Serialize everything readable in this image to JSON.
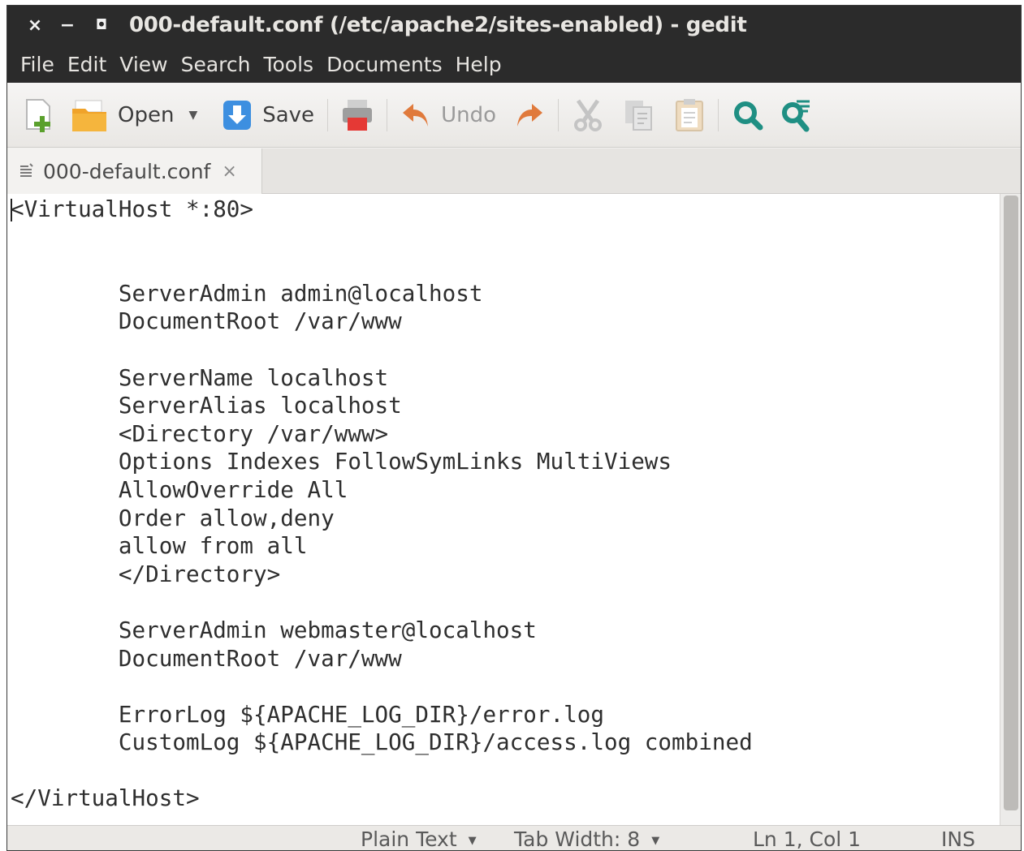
{
  "window": {
    "title": "000-default.conf (/etc/apache2/sites-enabled) - gedit",
    "controls": {
      "close": "×",
      "minimize": "−",
      "maximize": "◘"
    }
  },
  "menu": {
    "items": [
      "File",
      "Edit",
      "View",
      "Search",
      "Tools",
      "Documents",
      "Help"
    ]
  },
  "toolbar": {
    "open_label": "Open",
    "save_label": "Save",
    "undo_label": "Undo"
  },
  "tab": {
    "label": "000-default.conf",
    "close": "×"
  },
  "editor": {
    "lines": [
      "<VirtualHost *:80>",
      "",
      "",
      "        ServerAdmin admin@localhost",
      "        DocumentRoot /var/www",
      "",
      "        ServerName localhost",
      "        ServerAlias localhost",
      "        <Directory /var/www>",
      "        Options Indexes FollowSymLinks MultiViews",
      "        AllowOverride All",
      "        Order allow,deny",
      "        allow from all",
      "        </Directory>",
      "",
      "        ServerAdmin webmaster@localhost",
      "        DocumentRoot /var/www",
      "",
      "        ErrorLog ${APACHE_LOG_DIR}/error.log",
      "        CustomLog ${APACHE_LOG_DIR}/access.log combined",
      "",
      "</VirtualHost>"
    ]
  },
  "statusbar": {
    "language": "Plain Text",
    "tab_width": "Tab Width: 8",
    "position": "Ln 1, Col 1",
    "mode": "INS"
  },
  "icons": {
    "new": "new-document-icon",
    "open": "folder-icon",
    "save": "save-arrow-icon",
    "print": "printer-icon",
    "undo": "undo-icon",
    "redo": "redo-icon",
    "cut": "scissors-icon",
    "copy": "copy-icon",
    "paste": "paste-icon",
    "find": "search-icon",
    "replace": "find-replace-icon"
  },
  "colors": {
    "titlebar": "#2b2b2b",
    "accent_find": "#1f8f83",
    "save_blue": "#3d8fe0",
    "undo_orange": "#e07a3c",
    "new_green": "#5aa02c"
  }
}
